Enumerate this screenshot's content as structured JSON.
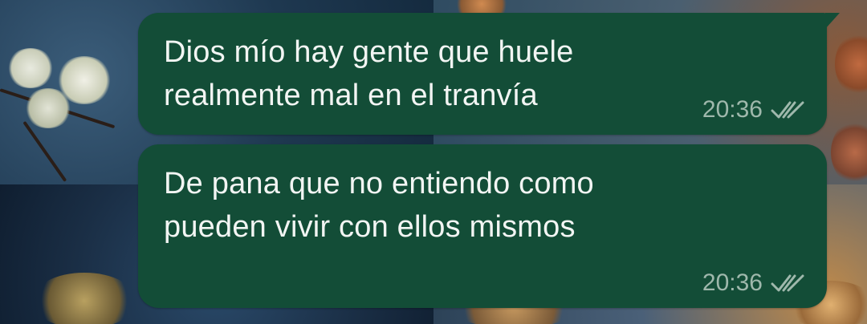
{
  "conversation": {
    "messages": [
      {
        "text_line1": "Dios mío hay gente que huele",
        "text_line2": "realmente mal en el tranvía",
        "time": "20:36",
        "status_icon": "double-check-icon"
      },
      {
        "text_line1": "De pana que no entiendo como",
        "text_line2": "pueden vivir con ellos mismos",
        "time": "20:36",
        "status_icon": "double-check-icon"
      }
    ]
  },
  "colors": {
    "bubble_outgoing": "#134d37",
    "message_text": "#f2f5f3",
    "meta_text": "#9fb8ac"
  }
}
